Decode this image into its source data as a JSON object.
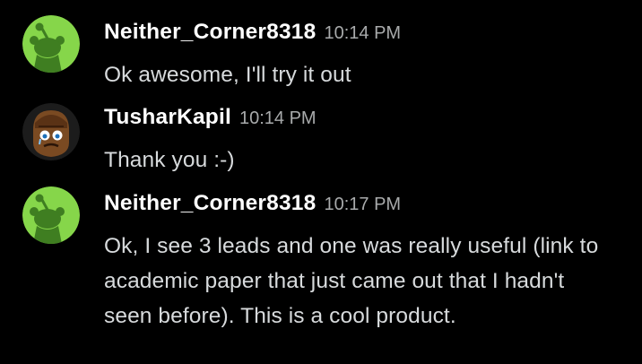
{
  "colors": {
    "background": "#000000",
    "username": "#ffffff",
    "timestamp": "#a8aaab",
    "message_text": "#d7dadc",
    "snoo_avatar_bg": "#86d64a"
  },
  "messages": [
    {
      "username": "Neither_Corner8318",
      "timestamp": "10:14 PM",
      "text": "Ok awesome, I'll try it out",
      "avatar": "snoo-avatar-icon"
    },
    {
      "username": "TusharKapil",
      "timestamp": "10:14 PM",
      "text": "Thank you :-)",
      "avatar": "cartoon-character-avatar-icon"
    },
    {
      "username": "Neither_Corner8318",
      "timestamp": "10:17 PM",
      "text": "Ok, I see 3 leads and one was really useful (link to academic paper that just came out that I hadn't seen before). This is a cool product.",
      "avatar": "snoo-avatar-icon"
    }
  ]
}
